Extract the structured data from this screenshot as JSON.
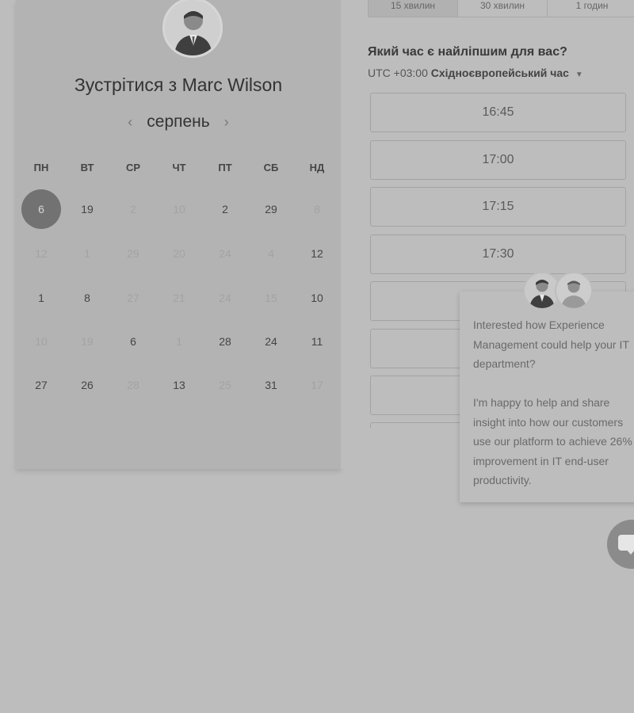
{
  "host": {
    "title_prefix": "Зустрітися з",
    "name": "Marc Wilson",
    "avatar_icon": "person-avatar"
  },
  "calendar": {
    "month": "серпень",
    "prev_icon": "chevron-left-icon",
    "next_icon": "chevron-right-icon",
    "weekdays": [
      "ПН",
      "ВТ",
      "СР",
      "ЧТ",
      "ПТ",
      "СБ",
      "НД"
    ],
    "weeks": [
      [
        {
          "d": "6",
          "state": "selected"
        },
        {
          "d": "19",
          "state": "available"
        },
        {
          "d": "2",
          "state": "disabled"
        },
        {
          "d": "10",
          "state": "disabled"
        },
        {
          "d": "2",
          "state": "available"
        },
        {
          "d": "29",
          "state": "available"
        },
        {
          "d": "8",
          "state": "disabled"
        }
      ],
      [
        {
          "d": "12",
          "state": "disabled"
        },
        {
          "d": "1",
          "state": "disabled"
        },
        {
          "d": "29",
          "state": "disabled"
        },
        {
          "d": "20",
          "state": "disabled"
        },
        {
          "d": "24",
          "state": "disabled"
        },
        {
          "d": "4",
          "state": "disabled"
        },
        {
          "d": "12",
          "state": "available"
        }
      ],
      [
        {
          "d": "1",
          "state": "available"
        },
        {
          "d": "8",
          "state": "available"
        },
        {
          "d": "27",
          "state": "disabled"
        },
        {
          "d": "21",
          "state": "disabled"
        },
        {
          "d": "24",
          "state": "disabled"
        },
        {
          "d": "15",
          "state": "disabled"
        },
        {
          "d": "10",
          "state": "available"
        }
      ],
      [
        {
          "d": "10",
          "state": "disabled"
        },
        {
          "d": "19",
          "state": "disabled"
        },
        {
          "d": "6",
          "state": "available"
        },
        {
          "d": "1",
          "state": "disabled"
        },
        {
          "d": "28",
          "state": "available"
        },
        {
          "d": "24",
          "state": "available"
        },
        {
          "d": "11",
          "state": "available"
        }
      ],
      [
        {
          "d": "27",
          "state": "available"
        },
        {
          "d": "26",
          "state": "available"
        },
        {
          "d": "28",
          "state": "disabled"
        },
        {
          "d": "13",
          "state": "available"
        },
        {
          "d": "25",
          "state": "disabled"
        },
        {
          "d": "31",
          "state": "available"
        },
        {
          "d": "17",
          "state": "disabled"
        }
      ]
    ]
  },
  "durations": {
    "options": [
      "15 хвилин",
      "30 хвилин",
      "1 годин"
    ],
    "selected": "15 хвилин"
  },
  "slots": {
    "question": "Який час є найліпшим для вас?",
    "tz_prefix": "UTC +03:00",
    "tz_name": "Східноєвропейський час",
    "times": [
      "16:45",
      "17:00",
      "17:15",
      "17:30",
      "",
      "",
      "",
      ""
    ]
  },
  "chat": {
    "message": "Interested how Experience Management could help your IT department?\n\nI'm happy to help and share insight into how our customers use our platform to achieve 26% improvement in IT end-user productivity.",
    "launcher_icon": "chat-bubble-icon"
  },
  "colors": {
    "overlay_bg": "#bdbdbd",
    "card_bg": "#b3b3b3",
    "selected_day": "#727272"
  }
}
